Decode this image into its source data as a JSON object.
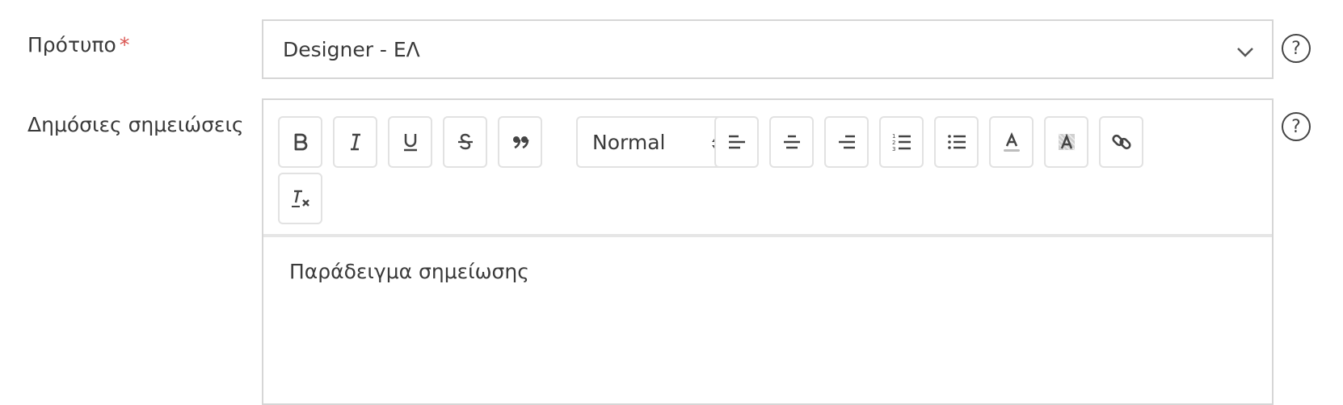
{
  "form": {
    "template": {
      "label": "Πρότυπο",
      "required_marker": "*",
      "value": "Designer - ΕΛ",
      "help_glyph": "?"
    },
    "public_notes": {
      "label": "Δημόσιες σημειώσεις",
      "help_glyph": "?",
      "content": "Παράδειγμα σημείωσης"
    }
  },
  "toolbar": {
    "format_select": "Normal",
    "icons": [
      "bold-icon",
      "italic-icon",
      "underline-icon",
      "strike-icon",
      "blockquote-icon",
      "align-left-icon",
      "align-center-icon",
      "align-right-icon",
      "ordered-list-icon",
      "bullet-list-icon",
      "text-color-icon",
      "background-color-icon",
      "link-icon",
      "clear-format-icon"
    ]
  }
}
